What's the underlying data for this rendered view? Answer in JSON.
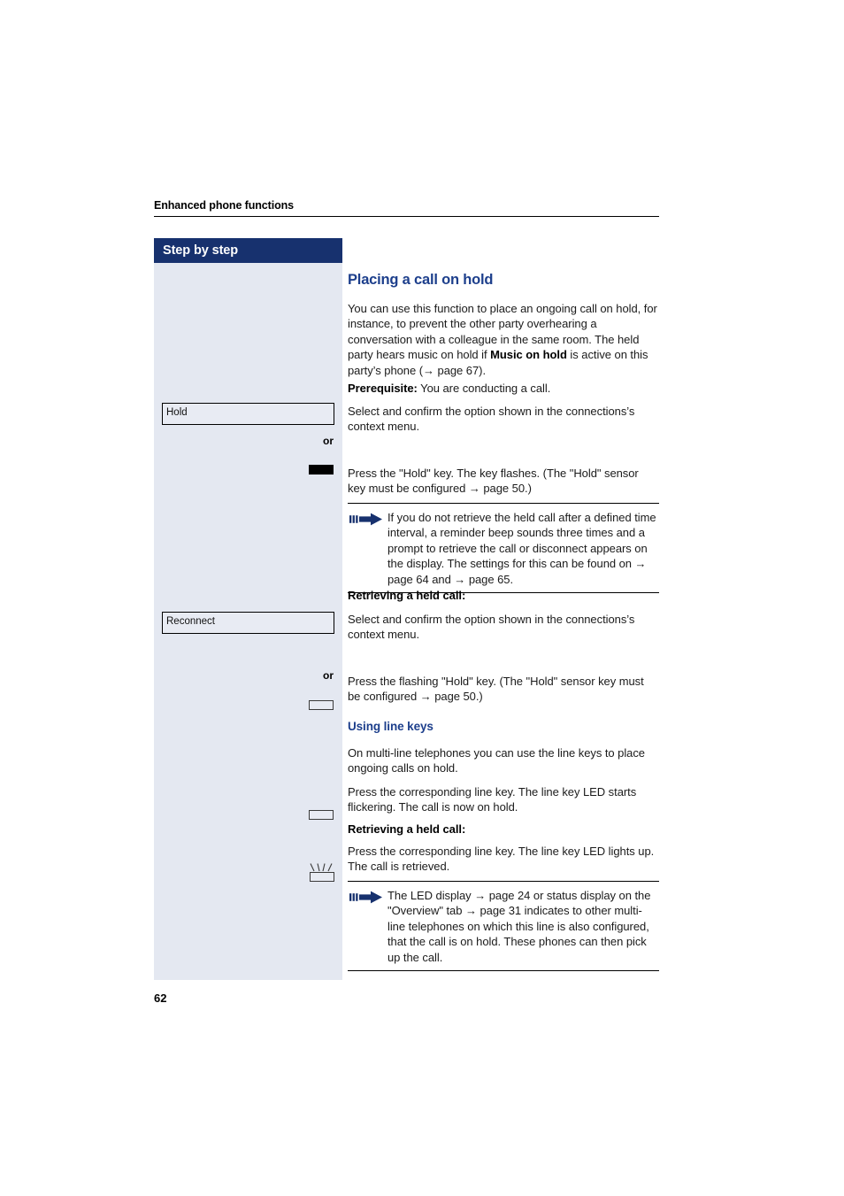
{
  "document": {
    "running_header": "Enhanced phone functions",
    "page_number": "62"
  },
  "colors": {
    "header_bar": "#17316e",
    "sidebar_bg": "#e4e8f1",
    "heading_blue": "#1d3f8c",
    "note_arrow": "#17316e",
    "text": "#1b1b1b"
  },
  "sidebar": {
    "title": "Step by step",
    "items": [
      {
        "type": "option-box",
        "label": "Hold"
      },
      {
        "type": "or",
        "label": "or"
      },
      {
        "type": "key-icon",
        "icon": "hold-key-flashing-icon"
      },
      {
        "type": "option-box",
        "label": "Reconnect"
      },
      {
        "type": "or",
        "label": "or"
      },
      {
        "type": "key-icon",
        "icon": "hold-key-outline-icon"
      },
      {
        "type": "key-icon",
        "icon": "line-key-outline-icon"
      },
      {
        "type": "key-icon",
        "icon": "line-key-lit-icon"
      }
    ],
    "option_hold": "Hold",
    "option_reconnect": "Reconnect",
    "or_label": "or"
  },
  "main": {
    "title": "Placing a call on hold",
    "intro": {
      "part1": "You can use this function to place an ongoing call on hold, for instance, to prevent the other party overhearing a conversation with a colleague in the same room. The held party hears music on hold if ",
      "bold": "Music on hold",
      "part2": " is active on this party’s phone (→ page 67)."
    },
    "prerequisite_label": "Prerequisite:",
    "prerequisite_text": " You are conducting a call.",
    "select_confirm_1": "Select and confirm the option shown in the connections’s context menu.",
    "press_hold_key": "Press the \"Hold\" key. The key flashes. (The \"Hold\" sensor key must be configured → page 50.)",
    "note_1": "If you do not retrieve the held call after a defined time interval, a reminder beep sounds three times and a prompt to retrieve the call or disconnect appears on the display. The settings for this can be found on → page 64 and → page 65.",
    "retrieving_heading_1": "Retrieving a held call:",
    "select_confirm_2": "Select and confirm the option shown in the connections’s context menu.",
    "press_flashing_hold_key": "Press the flashing \"Hold\" key. (The \"Hold\" sensor key must be configured → page 50.)",
    "using_line_keys_heading": "Using line keys",
    "using_line_keys_text": "On multi-line telephones you can use the line keys to place ongoing calls on hold.",
    "press_line_key_hold": "Press the corresponding line key. The line key LED starts flickering. The call is now on hold.",
    "retrieving_heading_2": "Retrieving a held call:",
    "press_line_key_retrieve": "Press the corresponding line key. The line key LED lights up. The call is retrieved.",
    "note_2": "The LED display → page 24 or status display on the \"Overview\" tab → page 31 indicates to other multi-line telephones on which this line is also configured, that the call is on hold. These phones can then pick up the call."
  }
}
